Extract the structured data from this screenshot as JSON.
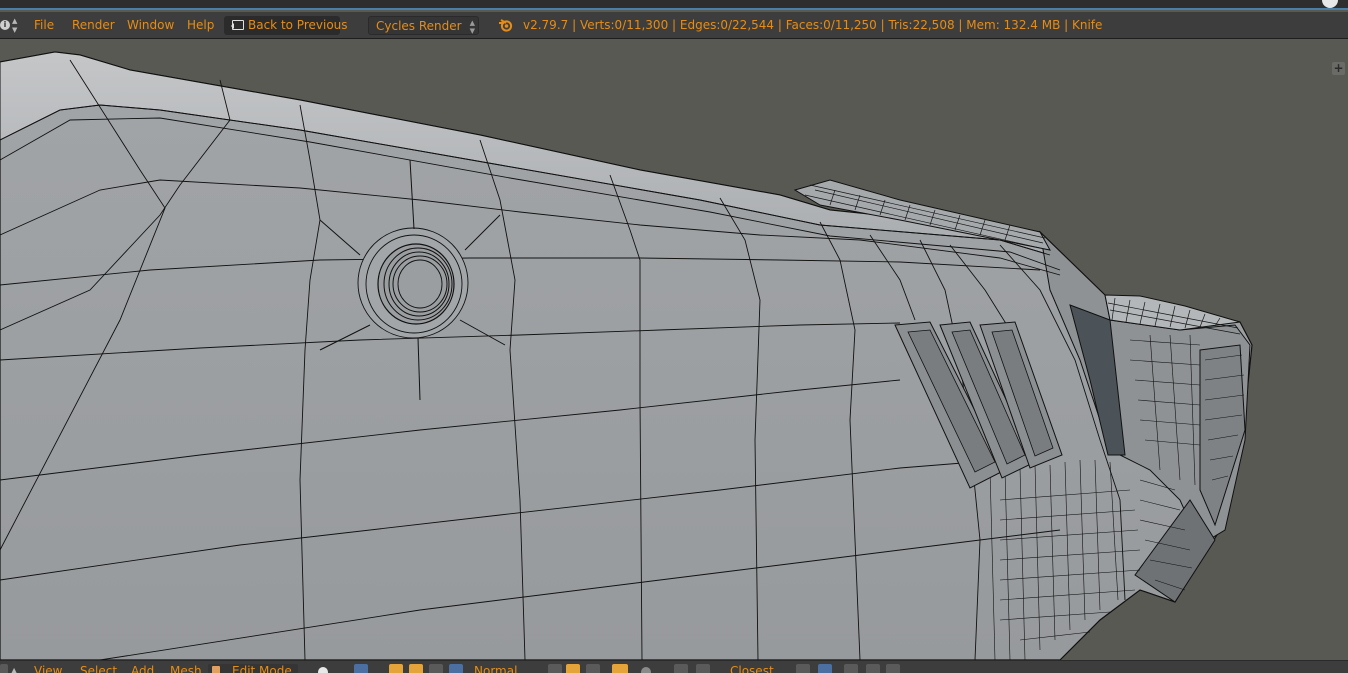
{
  "info_header": {
    "menus": [
      "File",
      "Render",
      "Window",
      "Help"
    ],
    "back_button": "Back to Previous",
    "render_engine": "Cycles Render",
    "stats": "v2.79.7 | Verts:0/11,300 | Edges:0/22,544 | Faces:0/11,250 | Tris:22,508 | Mem: 132.4 MB | Knife"
  },
  "viewport_header": {
    "menus": [
      "View",
      "Select",
      "Add",
      "Mesh"
    ],
    "mode": "Edit Mode",
    "pivot": "Normal",
    "snap": "Closest"
  },
  "colors": {
    "accent": "#e58d17",
    "header_bg": "#3d3d3d",
    "viewport_bg": "#595953",
    "mesh_fill": "#9ea1a4",
    "wire": "#111111",
    "selection_blue": "#4c7fa8"
  },
  "icons": {
    "editor_type": "info-icon",
    "back": "back-arrow-icon",
    "logo": "blender-logo-icon",
    "viewport_plus": "plus-icon"
  }
}
